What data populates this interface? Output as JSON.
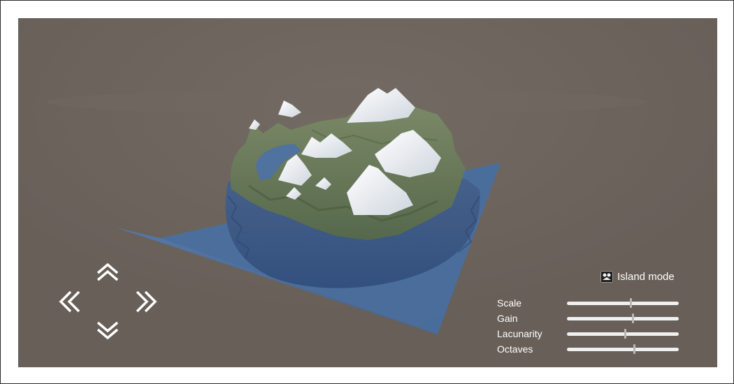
{
  "island_mode": {
    "label": "Island mode",
    "checked": true
  },
  "sliders": [
    {
      "label": "Scale",
      "value": 0.57
    },
    {
      "label": "Gain",
      "value": 0.59
    },
    {
      "label": "Lacunarity",
      "value": 0.52
    },
    {
      "label": "Octaves",
      "value": 0.6
    }
  ],
  "nav": {
    "up_icon": "double-chevron-up-icon",
    "down_icon": "double-chevron-down-icon",
    "left_icon": "double-chevron-left-icon",
    "right_icon": "double-chevron-right-icon"
  },
  "colors": {
    "background": "#6b645d",
    "water": "#4a6e9c",
    "grass": "#6f7f5a",
    "snow": "#f4f6f8"
  }
}
